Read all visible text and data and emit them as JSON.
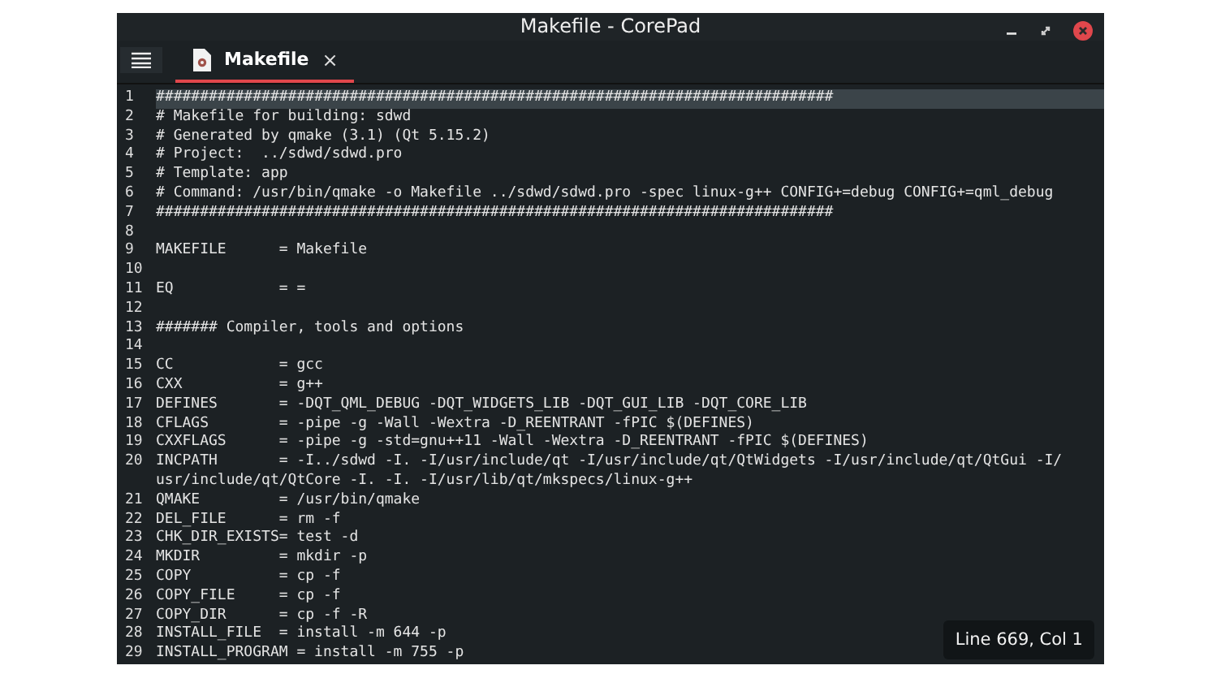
{
  "window": {
    "title": "Makefile - CorePad"
  },
  "tabs": [
    {
      "label": "Makefile",
      "close": "×",
      "selected": true
    }
  ],
  "editor": {
    "lines": [
      {
        "number": "1",
        "text": "#############################################################################",
        "current": true
      },
      {
        "number": "2",
        "text": "# Makefile for building: sdwd",
        "current": false
      },
      {
        "number": "3",
        "text": "# Generated by qmake (3.1) (Qt 5.15.2)",
        "current": false
      },
      {
        "number": "4",
        "text": "# Project:  ../sdwd/sdwd.pro",
        "current": false
      },
      {
        "number": "5",
        "text": "# Template: app",
        "current": false
      },
      {
        "number": "6",
        "text": "# Command: /usr/bin/qmake -o Makefile ../sdwd/sdwd.pro -spec linux-g++ CONFIG+=debug CONFIG+=qml_debug",
        "current": false
      },
      {
        "number": "7",
        "text": "#############################################################################",
        "current": false
      },
      {
        "number": "8",
        "current": false
      },
      {
        "number": "9",
        "text": "MAKEFILE      = Makefile",
        "current": false
      },
      {
        "number": "10",
        "current": false
      },
      {
        "number": "11",
        "text": "EQ            = =",
        "current": false
      },
      {
        "number": "12",
        "current": false
      },
      {
        "number": "13",
        "text": "####### Compiler, tools and options",
        "current": false
      },
      {
        "number": "14",
        "current": false
      },
      {
        "number": "15",
        "text": "CC            = gcc",
        "current": false
      },
      {
        "number": "16",
        "text": "CXX           = g++",
        "current": false
      },
      {
        "number": "17",
        "text": "DEFINES       = -DQT_QML_DEBUG -DQT_WIDGETS_LIB -DQT_GUI_LIB -DQT_CORE_LIB",
        "current": false
      },
      {
        "number": "18",
        "text": "CFLAGS        = -pipe -g -Wall -Wextra -D_REENTRANT -fPIC $(DEFINES)",
        "current": false
      },
      {
        "number": "19",
        "text": "CXXFLAGS      = -pipe -g -std=gnu++11 -Wall -Wextra -D_REENTRANT -fPIC $(DEFINES)",
        "current": false
      },
      {
        "number": "20",
        "text": "INCPATH       = -I../sdwd -I. -I/usr/include/qt -I/usr/include/qt/QtWidgets -I/usr/include/qt/QtGui -I/",
        "wrap": "usr/include/qt/QtCore -I. -I. -I/usr/lib/qt/mkspecs/linux-g++",
        "current": false
      },
      {
        "number": "21",
        "text": "QMAKE         = /usr/bin/qmake",
        "current": false
      },
      {
        "number": "22",
        "text": "DEL_FILE      = rm -f",
        "current": false
      },
      {
        "number": "23",
        "text": "CHK_DIR_EXISTS= test -d",
        "current": false
      },
      {
        "number": "24",
        "text": "MKDIR         = mkdir -p",
        "current": false
      },
      {
        "number": "25",
        "text": "COPY          = cp -f",
        "current": false
      },
      {
        "number": "26",
        "text": "COPY_FILE     = cp -f",
        "current": false
      },
      {
        "number": "27",
        "text": "COPY_DIR      = cp -f -R",
        "current": false
      },
      {
        "number": "28",
        "text": "INSTALL_FILE  = install -m 644 -p",
        "current": false
      },
      {
        "number": "29",
        "text": "INSTALL_PROGRAM = install -m 755 -p",
        "current": false
      }
    ]
  },
  "status": "Line 669, Col 1"
}
